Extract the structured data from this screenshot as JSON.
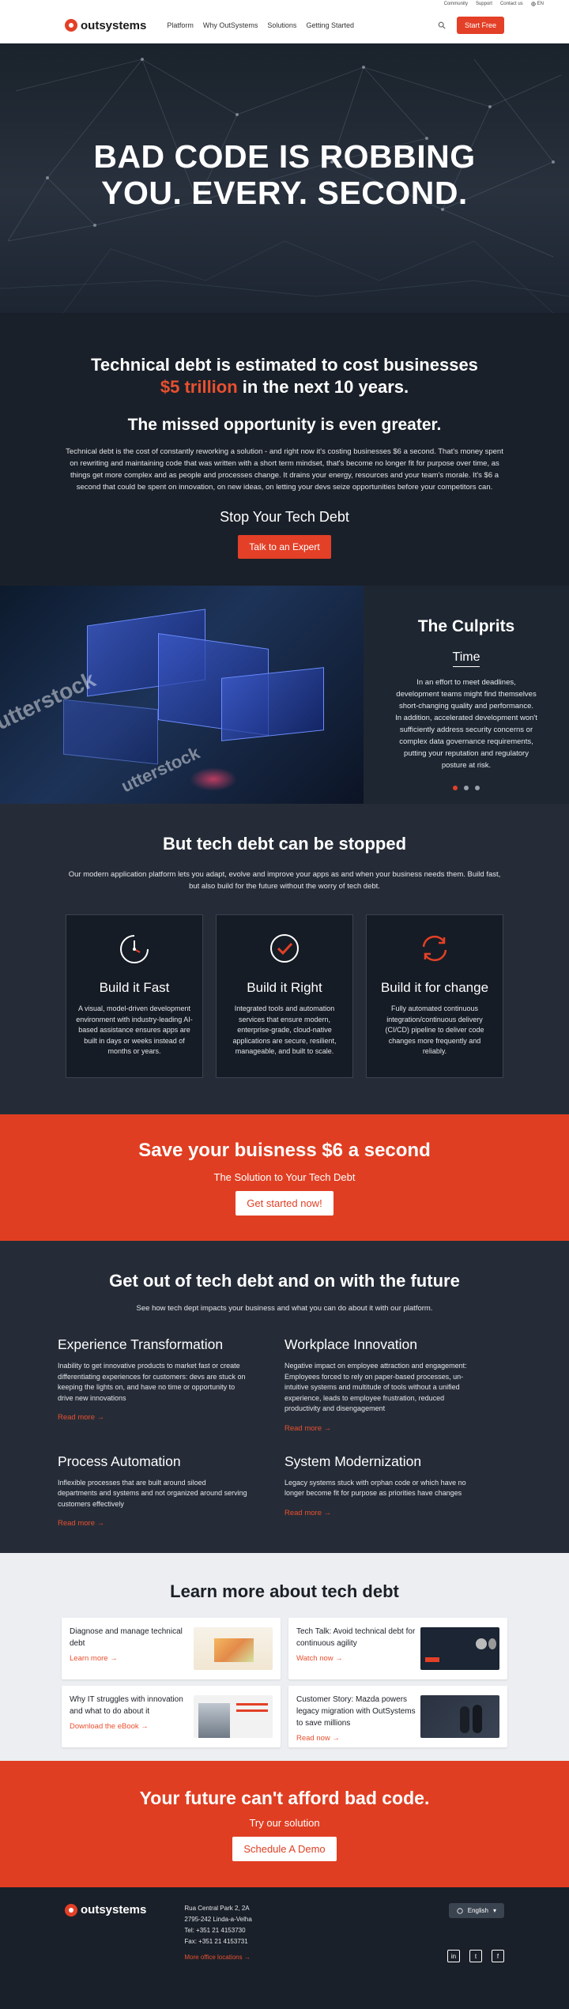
{
  "utility_bar": {
    "links": [
      "Community",
      "Support",
      "Contact us"
    ],
    "language": "EN"
  },
  "header": {
    "logo": "outsystems",
    "nav": [
      "Platform",
      "Why OutSystems",
      "Solutions",
      "Getting Started"
    ],
    "cta": "Start Free"
  },
  "hero": {
    "title_line1": "BAD CODE IS ROBBING",
    "title_line2": "YOU. EVERY. SECOND."
  },
  "debt": {
    "headline_pre": "Technical debt is estimated to cost businesses",
    "headline_accent": "$5 trillion",
    "headline_post": " in the next 10 years.",
    "subhead": "The missed opportunity is even greater.",
    "body": "Technical debt is the cost of constantly reworking a solution - and right now it's costing businesses $6 a second. That's money spent on rewriting and maintaining code that was written with a short term mindset, that's become no longer fit for purpose over time, as things get more complex and as people and processes change. It drains your energy, resources and your team's morale. It's $6 a second that could be spent on innovation, on new ideas, on letting your devs seize opportunities before your competitors can.",
    "cta_heading": "Stop Your Tech Debt",
    "cta_button": "Talk to an Expert"
  },
  "culprits": {
    "title": "The Culprits",
    "subtitle": "Time",
    "body": "In an effort to meet deadlines, development teams might find themselves short-changing quality and performance. In addition, accelerated development won't sufficiently address security concerns or complex data governance requirements, putting your reputation and regulatory posture at risk.",
    "watermark": "utterstock"
  },
  "stopped": {
    "title": "But tech debt can be stopped",
    "lead": "Our modern application platform lets you adapt, evolve and improve your apps as and when your business needs them. Build fast, but also build for the future without the worry of tech debt.",
    "cards": [
      {
        "title": "Build it Fast",
        "icon": "stopwatch-icon",
        "body": "A visual, model-driven development environment with industry-leading AI-based assistance ensures apps are built in days or weeks instead of months or years."
      },
      {
        "title": "Build it Right",
        "icon": "checkmark-circle-icon",
        "body": "Integrated tools and automation services that ensure modern, enterprise-grade, cloud-native applications are secure, resilient, manageable, and built to scale."
      },
      {
        "title": "Build it for change",
        "icon": "refresh-icon",
        "body": "Fully automated continuous integration/continuous delivery (CI/CD) pipeline to deliver code changes more frequently and reliably."
      }
    ]
  },
  "save": {
    "title": "Save your buisness $6 a second",
    "subtitle": "The Solution to Your Tech Debt",
    "button": "Get started now!"
  },
  "future": {
    "title": "Get out of tech debt and on with the future",
    "lead": "See how tech dept impacts your business and what you can do about it with our platform.",
    "items": [
      {
        "title": "Experience Transformation",
        "body": "Inability to get innovative products to market fast or create differentiating experiences for customers: devs are stuck on keeping the lights on, and have no time or opportunity to drive new innovations",
        "link": "Read more"
      },
      {
        "title": "Workplace Innovation",
        "body": "Negative impact on employee attraction and engagement: Employees forced to rely on paper-based processes, un-intuitive systems and multitude of tools without a unified experience, leads to employee frustration, reduced productivity and disengagement",
        "link": "Read more"
      },
      {
        "title": "Process Automation",
        "body": "Inflexible processes that are built around siloed departments and systems and not organized around serving customers effectively",
        "link": "Read more"
      },
      {
        "title": "System Modernization",
        "body": "Legacy systems stuck with orphan code or which have no longer become fit for purpose as priorities have changes",
        "link": "Read more"
      }
    ]
  },
  "learn": {
    "title": "Learn more about tech debt",
    "resources": [
      {
        "title": "Diagnose and manage technical debt",
        "link": "Learn more"
      },
      {
        "title": "Tech Talk: Avoid technical debt for continuous agility",
        "link": "Watch now"
      },
      {
        "title": "Why IT struggles with innovation and what to do about it",
        "link": "Download the eBook"
      },
      {
        "title": "Customer Story: Mazda powers legacy migration with OutSystems to save millions",
        "link": "Read now"
      }
    ]
  },
  "cta_bottom": {
    "title": "Your future can't afford bad code.",
    "subtitle": "Try our solution",
    "button": "Schedule A Demo"
  },
  "footer": {
    "logo": "outsystems",
    "address": [
      "Rua Central Park 2, 2A",
      "2795-242 Linda-a-Velha",
      "Tel: +351 21 4153730",
      "Fax: +351 21 4153731"
    ],
    "more_link": "More office locations",
    "language": "English",
    "social": [
      "in",
      "t",
      "f"
    ]
  },
  "colors": {
    "accent": "#e34027",
    "dark": "#1a2029",
    "panel": "#262c37"
  }
}
